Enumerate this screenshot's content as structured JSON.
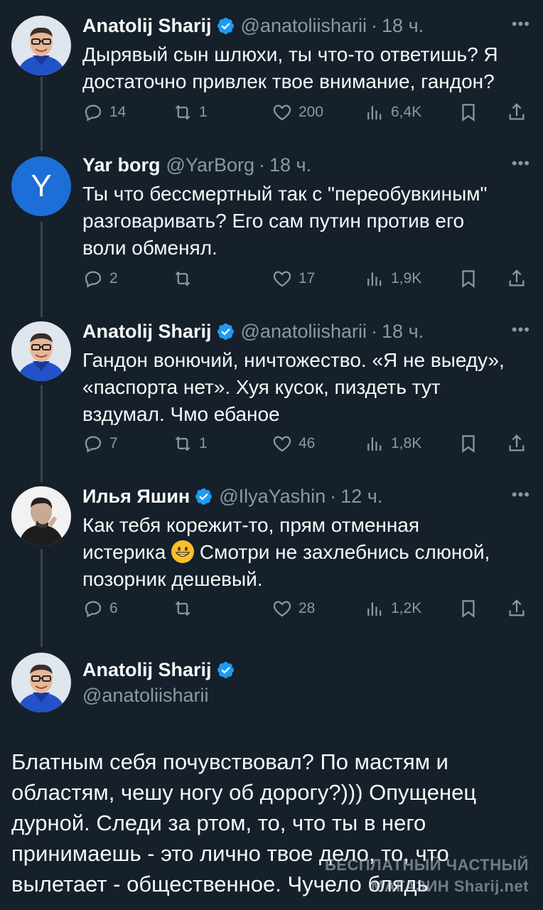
{
  "tweets": [
    {
      "name": "Anatolij Sharij",
      "verified": true,
      "handle": "@anatoliisharii",
      "time": "18 ч.",
      "text": "Дырявый сын шлюхи, ты что-то ответишь? Я\nдостаточно привлек твое внимание, гандон?",
      "replies": "14",
      "reposts": "1",
      "likes": "200",
      "views": "6,4K"
    },
    {
      "name": "Yar borg",
      "verified": false,
      "handle": "@YarBorg",
      "time": "18 ч.",
      "avatar_letter": "Y",
      "text": "Ты что бессмертный так с \"переобувкиным\"\nразговаривать? Его сам путин против его\nволи обменял.",
      "replies": "2",
      "reposts": "",
      "likes": "17",
      "views": "1,9K"
    },
    {
      "name": "Anatolij Sharij",
      "verified": true,
      "handle": "@anatoliisharii",
      "time": "18 ч.",
      "text": "Гандон вонючий, ничтожество. «Я не выеду»,\n«паспорта нет». Хуя кусок, пиздеть тут\nвздумал. Чмо ебаное",
      "replies": "7",
      "reposts": "1",
      "likes": "46",
      "views": "1,8K"
    },
    {
      "name": "Илья Яшин",
      "verified": true,
      "handle": "@IlyaYashin",
      "time": "12 ч.",
      "text_line1": "Как тебя корежит-то, прям отменная",
      "text_line2a": "истерика ",
      "text_line2b": " Смотри не захлебнись слюной,",
      "text_line3": "позорник дешевый.",
      "emoji": "grinning-face",
      "replies": "6",
      "reposts": "",
      "likes": "28",
      "views": "1,2K"
    }
  ],
  "main_tweet": {
    "name": "Anatolij Sharij",
    "verified": true,
    "handle": "@anatoliisharii",
    "text": "Блатным себя почувствовал? По мастям и\nобластям, чешу ногу об дорогу?))) Опущенец\nдурной. Следи за ртом, то, что ты в него\nпринимаешь - это лично твое дело, то, что\nвылетает - общественное. Чучело блядь"
  },
  "watermark": {
    "line1": "БЕСПЛАТНЫЙ ЧАСТНЫЙ",
    "line2": "МАГАЗИН Sharij.net"
  },
  "more_label": "•••",
  "dot_separator": "·",
  "colors": {
    "background": "#15202b",
    "text": "#f7f9f9",
    "secondary": "#8b98a5",
    "verified": "#1d9bf0",
    "thread_line": "#38444d"
  },
  "icons": [
    "reply-icon",
    "repost-icon",
    "like-icon",
    "views-icon",
    "bookmark-icon",
    "share-icon",
    "verified-badge-icon",
    "more-icon"
  ]
}
